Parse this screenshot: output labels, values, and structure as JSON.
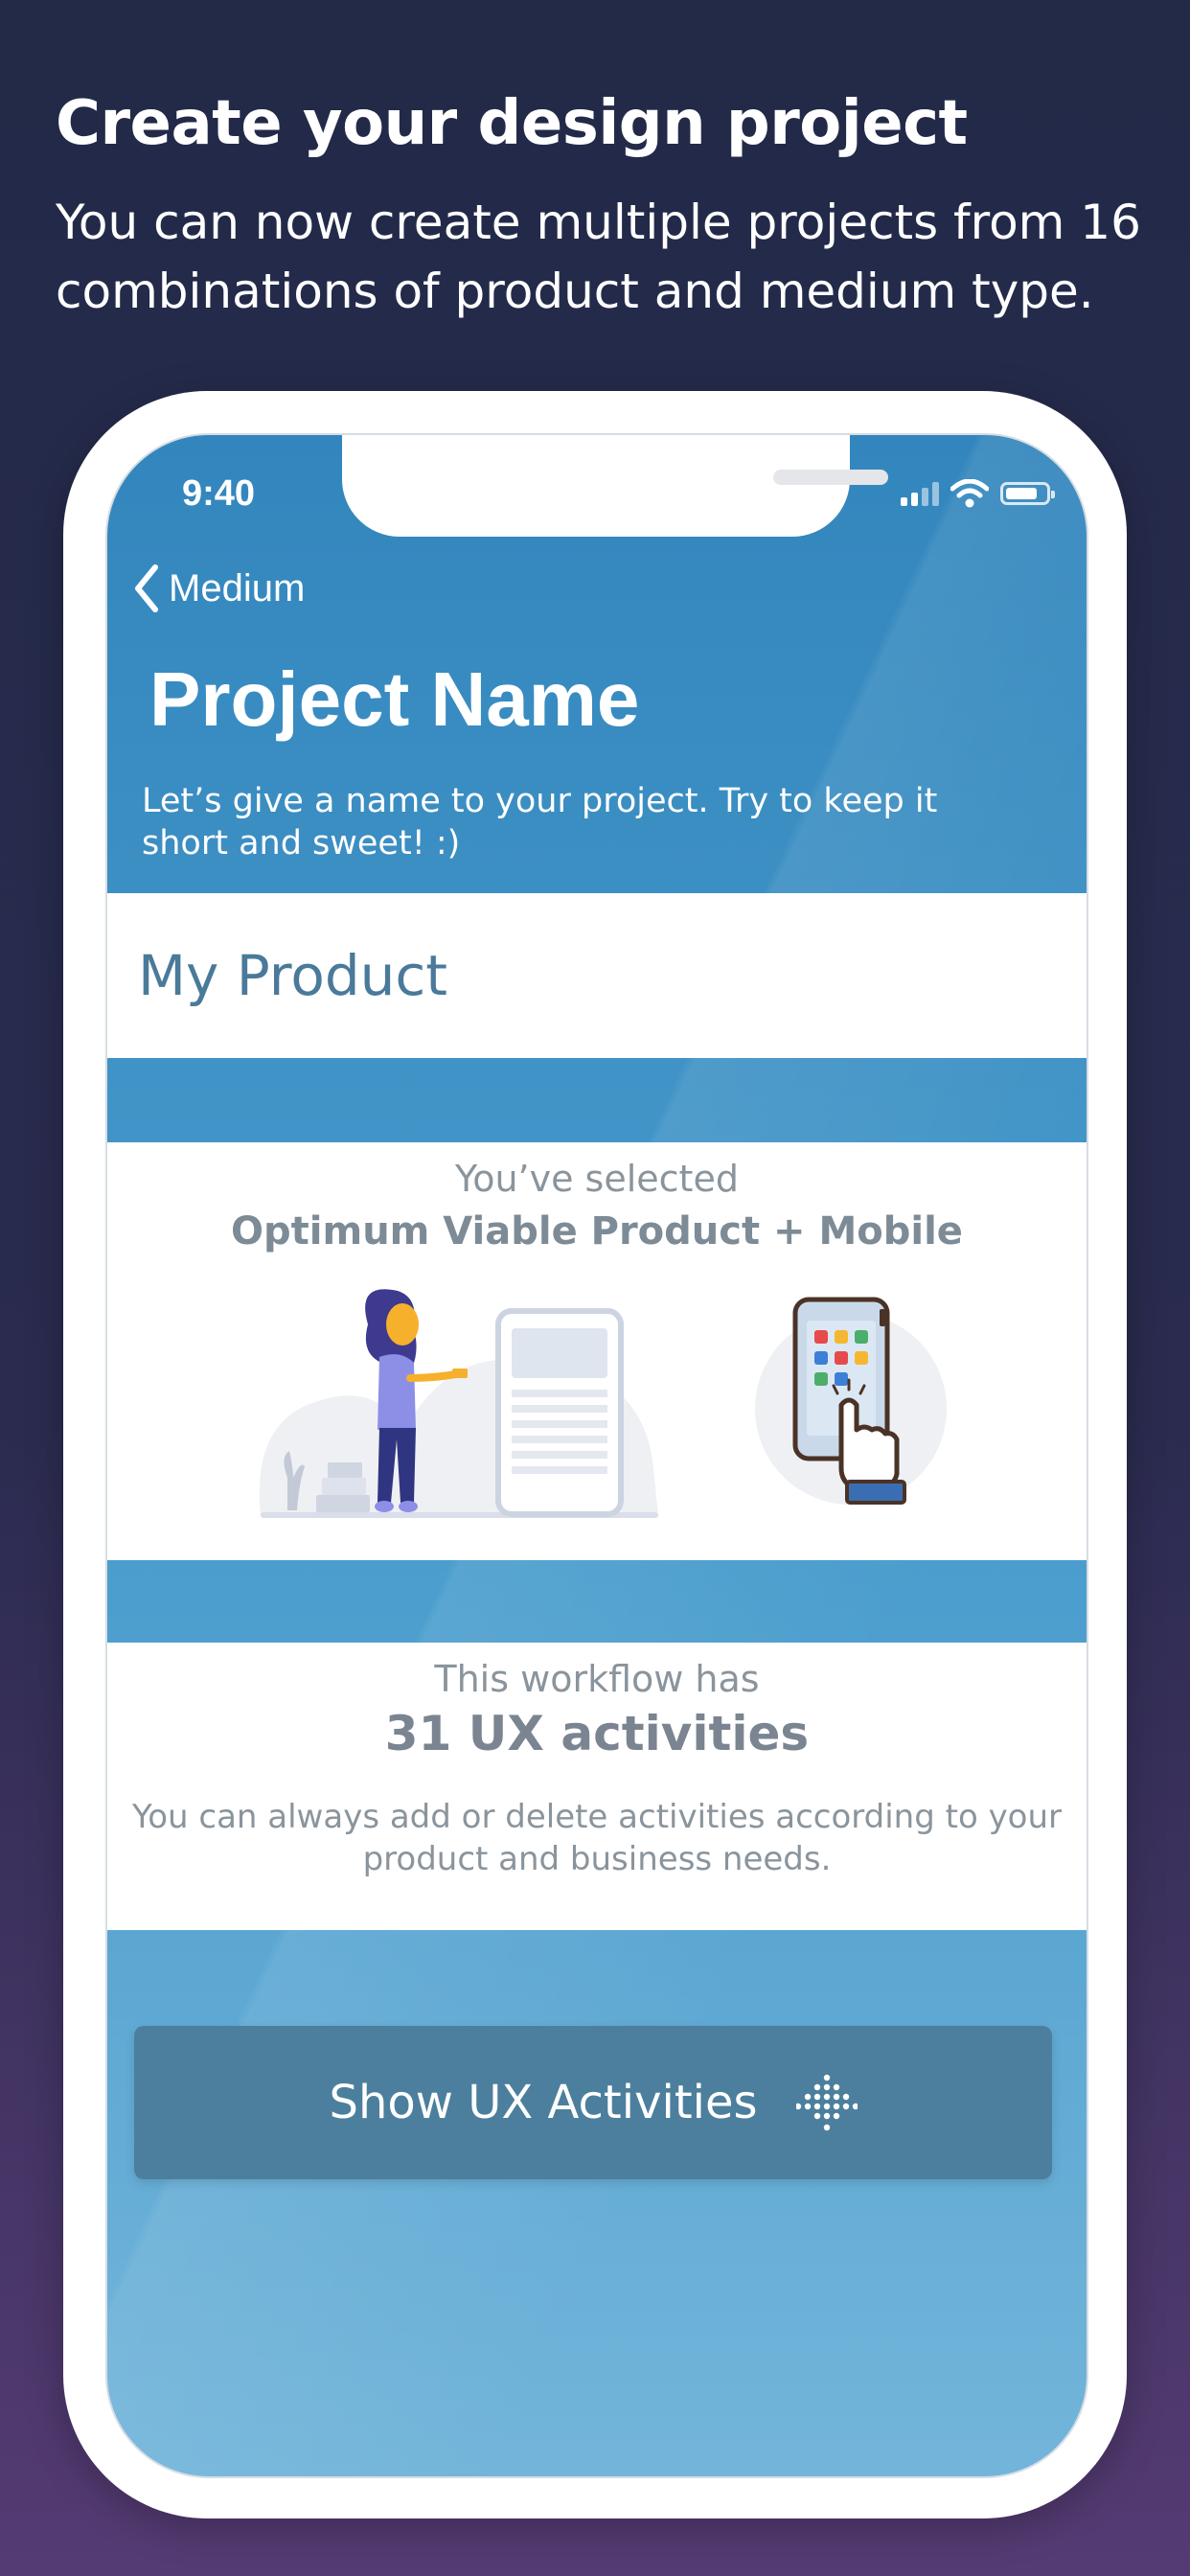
{
  "promo": {
    "title": "Create your design project",
    "subtitle": "You can now create multiple projects from 16 combinations of product and medium type."
  },
  "status_bar": {
    "time": "9:40",
    "icons": [
      "signal-icon",
      "wifi-icon",
      "battery-icon"
    ]
  },
  "nav": {
    "back_label": "Medium",
    "back_icon": "chevron-left-icon"
  },
  "header": {
    "title": "Project Name",
    "description": "Let’s give a name to your project. Try to keep it short and sweet! :)"
  },
  "project_name_field": {
    "value": "My Product"
  },
  "selection": {
    "caption": "You’ve selected",
    "value": "Optimum Viable Product + Mobile",
    "illustration": "woman-with-phone-illustration",
    "product_icon": "mobile-tap-icon"
  },
  "workflow": {
    "caption": "This workflow has",
    "count_text": "31 UX activities",
    "note": "You can always add or delete activities according to your product and business needs."
  },
  "action": {
    "label": "Show UX Activities",
    "icon": "dotted-arrow-down-icon"
  },
  "colors": {
    "background_top": "#222a48",
    "background_bottom": "#553b73",
    "screen_blue": "#3386bd",
    "button": "#4c7f9d",
    "field_text": "#4a7a9a"
  }
}
